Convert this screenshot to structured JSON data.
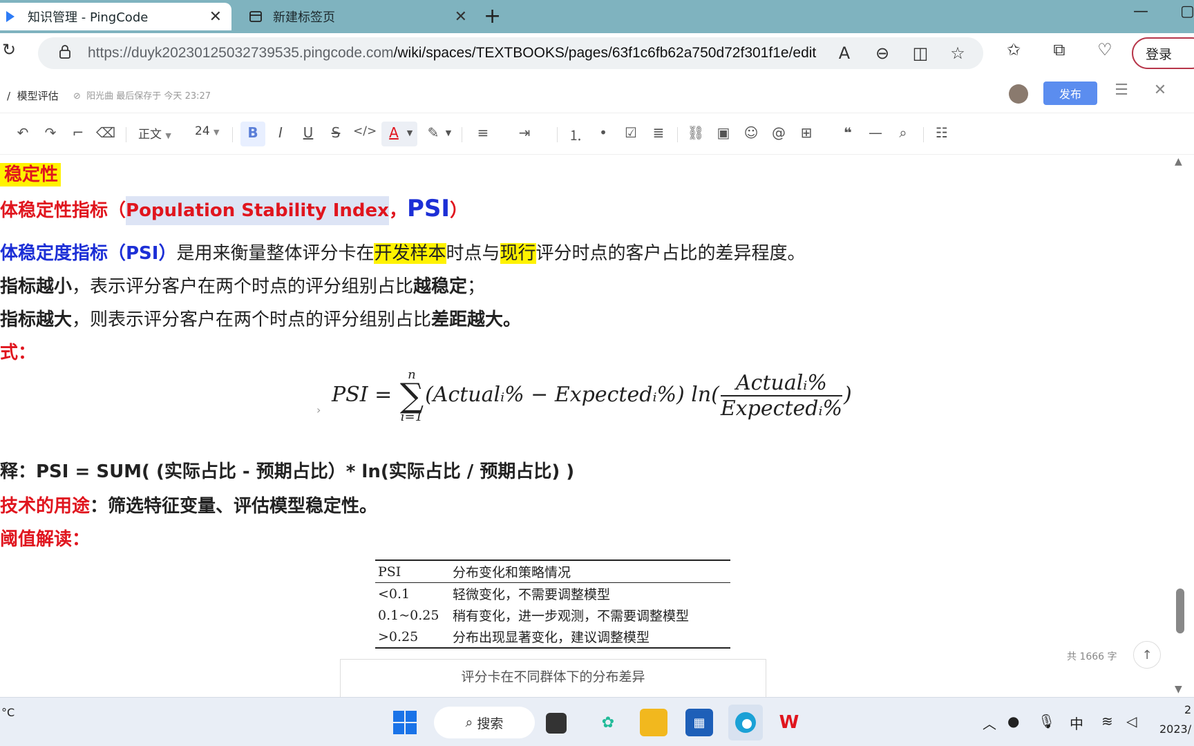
{
  "browser": {
    "tabs": [
      {
        "title": "知识管理 - PingCode",
        "close": "✕"
      },
      {
        "title": "新建标签页",
        "close": "✕"
      }
    ],
    "new_tab": "+",
    "url_host": "https://duyk20230125032739535.pingcode.com",
    "url_path": "/wiki/spaces/TEXTBOOKS/pages/63f1c6fb62a750d72f301f1e/edit",
    "login_label": "登录"
  },
  "doc_header": {
    "breadcrumb_sep": "/",
    "breadcrumb": "模型评估",
    "saved_status": "阳光曲 最后保存于 今天 23:27",
    "publish_label": "发布"
  },
  "toolbar": {
    "paragraph_style": "正文",
    "font_size": "24"
  },
  "content": {
    "section_title": "稳定性",
    "heading_part1": "体稳定性指标（",
    "heading_selected": "Population Stability Index",
    "heading_part2": "，",
    "heading_psi": "PSI",
    "heading_close": "）",
    "def_blue": "体稳定度指标（PSI）",
    "def_text1": "是用来衡量整体评分卡在",
    "def_hl1": "开发样本",
    "def_text2": "时点与",
    "def_hl2": "现行",
    "def_text3": "评分时点的客户占比的差异程度。",
    "small_bold": "指标越小",
    "small_text1": "，表示评分客户在两个时点的评分组别占比",
    "small_bold2": "越稳定",
    "small_text2": "；",
    "big_bold": "指标越大",
    "big_text1": "，则表示评分客户在两个时点的评分组别占比",
    "big_bold2": "差距越大。",
    "formula_label": "式：",
    "formula_lhs": "PSI =",
    "formula_sum_top": "n",
    "formula_sum_bottom": "i=1",
    "formula_body": "(Actualᵢ% − Expectedᵢ%) ln(",
    "formula_num": "Actualᵢ%",
    "formula_den": "Expectedᵢ%",
    "formula_close": ")",
    "explain": "释：PSI = SUM( (实际占比 - 预期占比）* ln(实际占比 / 预期占比) )",
    "usage_label": "技术的用途",
    "usage_text": "：筛选特征变量、评估模型稳定性。",
    "threshold_label": "阈值解读：",
    "table_header": [
      "PSI",
      "分布变化和策略情况"
    ],
    "table_rows": [
      [
        "<0.1",
        "轻微变化，不需要调整模型"
      ],
      [
        "0.1~0.25",
        "稍有变化，进一步观测，不需要调整模型"
      ],
      [
        ">0.25",
        "分布出现显著变化，建议调整模型"
      ]
    ],
    "caption": "评分卡在不同群体下的分布差异",
    "word_count": "共 1666 字"
  },
  "taskbar": {
    "weather": "°C",
    "search_label": "搜索",
    "ime": "中",
    "clock": "2",
    "date": "2023/"
  },
  "colors": {
    "accent": "#5b8def",
    "heading_red": "#e0151e",
    "heading_blue": "#1c2fd6",
    "highlight": "#fff200",
    "tabstrip": "#7fb3bf"
  }
}
